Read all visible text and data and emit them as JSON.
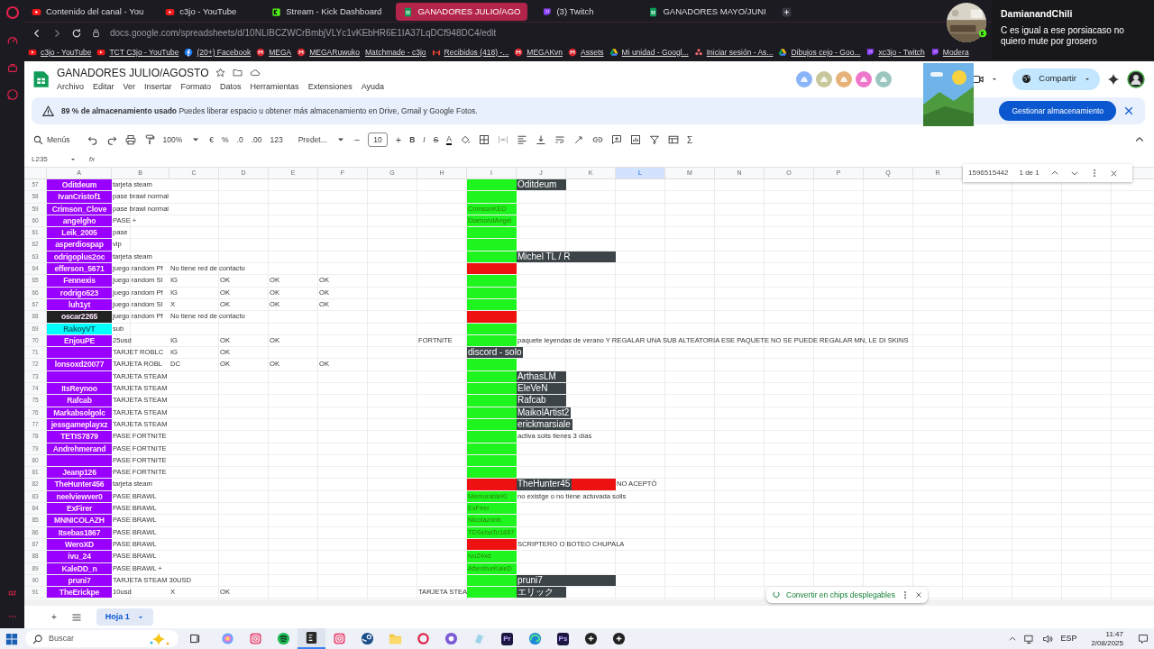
{
  "browser": {
    "tabs": [
      {
        "label": "Contenido del canal - You",
        "kind": "video",
        "selected": false
      },
      {
        "label": "c3jo - YouTube",
        "kind": "video",
        "selected": false
      },
      {
        "label": "Stream - Kick Dashboard",
        "kind": "kick",
        "selected": false
      },
      {
        "label": "GANADORES JULIO/AGO",
        "kind": "sheet",
        "selected": true
      },
      {
        "label": "(3) Twitch",
        "kind": "twitch",
        "selected": false
      },
      {
        "label": "GANADORES MAYO/JUNI",
        "kind": "sheet",
        "selected": false
      }
    ],
    "address": "docs.google.com/spreadsheets/d/10NLIBCZWCrBmbjVLYc1vKEbHR6E1IA37LqDCf948DC4/edit",
    "bookmarks": [
      {
        "label": "c3jo - YouTube",
        "kind": "video"
      },
      {
        "label": "TCT C3jo - YouTube",
        "kind": "video"
      },
      {
        "label": "(20+) Facebook",
        "kind": "social"
      },
      {
        "label": "MEGA",
        "kind": "mega"
      },
      {
        "label": "MEGARuwuko",
        "kind": "mega"
      },
      {
        "label": "Matchmade - c3jo",
        "kind": "blank"
      },
      {
        "label": "Recibidos (418) -...",
        "kind": "mail"
      },
      {
        "label": "MEGAKvn",
        "kind": "mega"
      },
      {
        "label": "Assets",
        "kind": "mega"
      },
      {
        "label": "Mi unidad - Googl...",
        "kind": "drive"
      },
      {
        "label": "Iniciar sesión - As...",
        "kind": "dots"
      },
      {
        "label": "Dibujos cejo - Goo...",
        "kind": "drive"
      },
      {
        "label": "xc3jo - Twitch",
        "kind": "twitch"
      },
      {
        "label": "Modera",
        "kind": "twitch"
      }
    ]
  },
  "notification": {
    "user": "DamianandChili",
    "message": "C es igual a ese porsiacaso no quiero mute por grosero"
  },
  "sheet": {
    "title": "GANADORES JULIO/AGOSTO",
    "menu": [
      "Archivo",
      "Editar",
      "Ver",
      "Insertar",
      "Formato",
      "Datos",
      "Herramientas",
      "Extensiones",
      "Ayuda"
    ],
    "collaborators": [
      {
        "color": "#8ab4f8"
      },
      {
        "color": "#c8c89c"
      },
      {
        "color": "#e6b27a"
      },
      {
        "color": "#ee77cc"
      },
      {
        "color": "#9cc7c0"
      }
    ],
    "share": "Compartir",
    "banner": {
      "text": "**89 % de almacenamiento usado** Puedes liberar espacio u obtener más almacenamiento en Drive, Gmail y Google Fotos.",
      "button": "Gestionar almacenamiento"
    },
    "toolbar": {
      "search": "Menús",
      "zoom": "100%",
      "currency": "€",
      "percent": "%",
      "dec_less": ".0",
      "dec_more": ".00",
      "number_format": "123",
      "font": "Predet...",
      "minus": "−",
      "font_size": "10",
      "plus": "+",
      "bold": "B",
      "italic": "I",
      "strike": "S",
      "text_color": "A",
      "sum": "Σ"
    },
    "name_box": "L235",
    "fx": "fx",
    "find": {
      "query": "1596515442",
      "count": "1 de 1"
    },
    "columns": [
      {
        "label": "A",
        "selected": false
      },
      {
        "label": "B",
        "selected": false
      },
      {
        "label": "C",
        "selected": false
      },
      {
        "label": "D",
        "selected": false
      },
      {
        "label": "E",
        "selected": false
      },
      {
        "label": "F",
        "selected": false
      },
      {
        "label": "G",
        "selected": false
      },
      {
        "label": "H",
        "selected": false
      },
      {
        "label": "I",
        "selected": false
      },
      {
        "label": "J",
        "selected": false
      },
      {
        "label": "K",
        "selected": false
      },
      {
        "label": "L",
        "selected": true
      },
      {
        "label": "M",
        "selected": false
      },
      {
        "label": "N",
        "selected": false
      },
      {
        "label": "O",
        "selected": false
      },
      {
        "label": "P",
        "selected": false
      },
      {
        "label": "Q",
        "selected": false
      },
      {
        "label": "R",
        "selected": false
      }
    ],
    "rows": [
      {
        "n": "57",
        "cells": [
          {
            "kind": "name",
            "text": "Oditdeum",
            "color": "#9900ff"
          },
          {
            "kind": "plain",
            "text": "tarjeta steam"
          },
          "",
          "",
          "",
          "",
          "",
          "",
          {
            "kind": "plain",
            "color": "#1ef51e"
          },
          {
            "kind": "chip",
            "text": "Oditdeum",
            "color": "#3c4448"
          }
        ]
      },
      {
        "n": "58",
        "cells": [
          {
            "kind": "name",
            "text": "IvanCristof1",
            "color": "#9900ff"
          },
          {
            "kind": "plain",
            "text": "pase brawl normal"
          },
          "",
          "",
          "",
          "",
          "",
          "",
          {
            "kind": "plain",
            "color": "#1ef51e"
          }
        ]
      },
      {
        "n": "59",
        "cells": [
          {
            "kind": "name",
            "text": "Crimson_Clove",
            "color": "#9900ff"
          },
          {
            "kind": "plain",
            "text": "pase brawl normal"
          },
          "",
          "",
          "",
          "",
          "",
          "",
          {
            "kind": "note",
            "text": "CrimsonKED",
            "color": "#1ef51e"
          }
        ]
      },
      {
        "n": "60",
        "cells": [
          {
            "kind": "name",
            "text": "angelgho",
            "color": "#9900ff"
          },
          {
            "kind": "plain",
            "text": "PASE +"
          },
          "",
          "",
          "",
          "",
          "",
          "",
          {
            "kind": "note",
            "text": "DiamondAngel",
            "color": "#1ef51e"
          }
        ]
      },
      {
        "n": "61",
        "cells": [
          {
            "kind": "name",
            "text": "Leik_2005",
            "color": "#9900ff"
          },
          {
            "kind": "plain",
            "text": "pase"
          },
          "",
          "",
          "",
          "",
          "",
          "",
          {
            "kind": "plain",
            "color": "#1ef51e"
          }
        ]
      },
      {
        "n": "62",
        "cells": [
          {
            "kind": "name",
            "text": "asperdiospap",
            "color": "#9900ff"
          },
          {
            "kind": "plain",
            "text": "vip"
          },
          "",
          "",
          "",
          "",
          "",
          "",
          {
            "kind": "plain",
            "color": "#1ef51e"
          }
        ]
      },
      {
        "n": "63",
        "cells": [
          {
            "kind": "name",
            "text": "odrigoplus2oc",
            "color": "#9900ff"
          },
          {
            "kind": "plain",
            "text": "tarjeta steam"
          },
          "",
          "",
          "",
          "",
          "",
          "",
          {
            "kind": "plain",
            "color": "#1ef51e"
          },
          {
            "kind": "chip",
            "text": "Michel TL / R",
            "color": "#3c4448",
            "merged": true
          }
        ]
      },
      {
        "n": "64",
        "cells": [
          {
            "kind": "name",
            "text": "efferson_5671",
            "color": "#9900ff"
          },
          {
            "kind": "plain",
            "text": "juego random Pf"
          },
          {
            "kind": "plain",
            "text": "No tiene red de contacto"
          },
          "",
          "",
          "",
          "",
          "",
          {
            "kind": "plain",
            "color": "#ee1111"
          }
        ]
      },
      {
        "n": "65",
        "cells": [
          {
            "kind": "name",
            "text": "Fennexis",
            "color": "#9900ff"
          },
          {
            "kind": "plain",
            "text": "juego random Sl"
          },
          {
            "kind": "plain",
            "text": "IG"
          },
          {
            "kind": "plain",
            "text": "OK"
          },
          {
            "kind": "plain",
            "text": "OK"
          },
          {
            "kind": "plain",
            "text": "OK"
          },
          "",
          "",
          {
            "kind": "plain",
            "color": "#1ef51e"
          }
        ]
      },
      {
        "n": "66",
        "cells": [
          {
            "kind": "name",
            "text": "rodrigo523",
            "color": "#9900ff"
          },
          {
            "kind": "plain",
            "text": "juego random Pf"
          },
          {
            "kind": "plain",
            "text": "IG"
          },
          {
            "kind": "plain",
            "text": "OK"
          },
          {
            "kind": "plain",
            "text": "OK"
          },
          {
            "kind": "plain",
            "text": "OK"
          },
          "",
          "",
          {
            "kind": "plain",
            "color": "#1ef51e"
          }
        ]
      },
      {
        "n": "67",
        "cells": [
          {
            "kind": "name",
            "text": "luh1yt",
            "color": "#9900ff"
          },
          {
            "kind": "plain",
            "text": "juego random Sl"
          },
          {
            "kind": "plain",
            "text": "X"
          },
          {
            "kind": "plain",
            "text": "OK"
          },
          {
            "kind": "plain",
            "text": "OK"
          },
          {
            "kind": "plain",
            "text": "OK"
          },
          "",
          "",
          {
            "kind": "plain",
            "color": "#1ef51e"
          }
        ]
      },
      {
        "n": "68",
        "cells": [
          {
            "kind": "name",
            "text": "oscar2265",
            "color": "#222222"
          },
          {
            "kind": "plain",
            "text": "juego random Pf"
          },
          {
            "kind": "plain",
            "text": "No tiene red de contacto"
          },
          "",
          "",
          "",
          "",
          "",
          {
            "kind": "plain",
            "color": "#ee1111"
          }
        ]
      },
      {
        "n": "69",
        "cells": [
          {
            "kind": "name",
            "text": "RakoyVT",
            "color": "#00ffff"
          },
          {
            "kind": "plain",
            "text": "sub"
          },
          "",
          "",
          "",
          "",
          "",
          "",
          {
            "kind": "plain",
            "color": "#1ef51e"
          }
        ]
      },
      {
        "n": "70",
        "cells": [
          {
            "kind": "name",
            "text": "EnjouPE",
            "color": "#9900ff"
          },
          {
            "kind": "plain",
            "text": "25usd"
          },
          {
            "kind": "plain",
            "text": "IG"
          },
          {
            "kind": "plain",
            "text": "OK"
          },
          {
            "kind": "plain",
            "text": "OK"
          },
          "",
          "",
          {
            "kind": "plain",
            "text": "FORTNITE"
          },
          {
            "kind": "plain",
            "color": "#1ef51e"
          },
          {
            "kind": "plain",
            "text": "paquete leyendas de verano Y REGALAR UNA SUB ALTEATORIA   ESE PAQUETE NO SE PUEDE REGALAR MN, LE DI SKINS"
          }
        ]
      },
      {
        "n": "71",
        "cells": [
          {
            "kind": "name",
            "color": "#9900ff"
          },
          {
            "kind": "plain",
            "text": "TARJET ROBLC"
          },
          {
            "kind": "plain",
            "text": "IG"
          },
          {
            "kind": "plain",
            "text": "OK"
          },
          "",
          "",
          "",
          "",
          {
            "kind": "chip",
            "text": "discord - solo",
            "color": "#3c4448"
          }
        ]
      },
      {
        "n": "72",
        "cells": [
          {
            "kind": "name",
            "text": "lonsoxd20077",
            "color": "#9900ff"
          },
          {
            "kind": "plain",
            "text": "TARJETA ROBL"
          },
          {
            "kind": "plain",
            "text": "DC"
          },
          {
            "kind": "plain",
            "text": "OK"
          },
          {
            "kind": "plain",
            "text": "OK"
          },
          {
            "kind": "plain",
            "text": "OK"
          },
          "",
          "",
          {
            "kind": "plain",
            "color": "#1ef51e"
          }
        ]
      },
      {
        "n": "73",
        "cells": [
          {
            "kind": "name",
            "color": "#9900ff"
          },
          {
            "kind": "plain",
            "text": "TARJETA STEAM"
          },
          "",
          "",
          "",
          "",
          "",
          "",
          {
            "kind": "plain",
            "color": "#1ef51e"
          },
          {
            "kind": "chip",
            "text": "ArthasLM",
            "color": "#3c4448"
          }
        ]
      },
      {
        "n": "74",
        "cells": [
          {
            "kind": "name",
            "text": "ItsReynoo",
            "color": "#9900ff"
          },
          {
            "kind": "plain",
            "text": "TARJETA STEAM"
          },
          "",
          "",
          "",
          "",
          "",
          "",
          {
            "kind": "plain",
            "color": "#1ef51e"
          },
          {
            "kind": "chip",
            "text": "EleVeN",
            "color": "#3c4448"
          }
        ]
      },
      {
        "n": "75",
        "cells": [
          {
            "kind": "name",
            "text": "Rafcab",
            "color": "#9900ff"
          },
          {
            "kind": "plain",
            "text": "TARJETA STEAM"
          },
          "",
          "",
          "",
          "",
          "",
          "",
          {
            "kind": "plain",
            "color": "#1ef51e"
          },
          {
            "kind": "chip",
            "text": "Rafcab",
            "color": "#3c4448"
          }
        ]
      },
      {
        "n": "76",
        "cells": [
          {
            "kind": "name",
            "text": "Markabsolgolc",
            "color": "#9900ff"
          },
          {
            "kind": "plain",
            "text": "TARJETA STEAM"
          },
          "",
          "",
          "",
          "",
          "",
          "",
          {
            "kind": "plain",
            "color": "#1ef51e"
          },
          {
            "kind": "chip",
            "text": "MaikolArtist2",
            "color": "#3c4448"
          }
        ]
      },
      {
        "n": "77",
        "cells": [
          {
            "kind": "name",
            "text": "jessgameplayxz",
            "color": "#9900ff"
          },
          {
            "kind": "plain",
            "text": "TARJETA STEAM"
          },
          "",
          "",
          "",
          "",
          "",
          "",
          {
            "kind": "plain",
            "color": "#1ef51e"
          },
          {
            "kind": "chip",
            "text": "erickmarsiale",
            "color": "#3c4448"
          }
        ]
      },
      {
        "n": "78",
        "cells": [
          {
            "kind": "name",
            "text": "TETIS7879",
            "color": "#9900ff"
          },
          {
            "kind": "plain",
            "text": "PASE FORTNITE"
          },
          "",
          "",
          "",
          "",
          "",
          "",
          {
            "kind": "plain",
            "color": "#1ef51e"
          },
          {
            "kind": "plain",
            "text": "activa solis tienes 3 días"
          }
        ]
      },
      {
        "n": "79",
        "cells": [
          {
            "kind": "name",
            "text": "Andrehmerand",
            "color": "#9900ff"
          },
          {
            "kind": "plain",
            "text": "PASE FORTNITE"
          },
          "",
          "",
          "",
          "",
          "",
          "",
          {
            "kind": "plain",
            "color": "#1ef51e"
          }
        ]
      },
      {
        "n": "80",
        "cells": [
          {
            "kind": "name",
            "color": "#9900ff"
          },
          {
            "kind": "plain",
            "text": "PASE FORTNITE"
          },
          "",
          "",
          "",
          "",
          "",
          "",
          {
            "kind": "plain",
            "color": "#1ef51e"
          }
        ]
      },
      {
        "n": "81",
        "cells": [
          {
            "kind": "name",
            "text": "Jeanp126",
            "color": "#9900ff"
          },
          {
            "kind": "plain",
            "text": "PASE FORTNITE"
          },
          "",
          "",
          "",
          "",
          "",
          "",
          {
            "kind": "plain",
            "color": "#1ef51e"
          }
        ]
      },
      {
        "n": "82",
        "cells": [
          {
            "kind": "name",
            "text": "TheHunter456",
            "color": "#9900ff"
          },
          {
            "kind": "plain",
            "text": "tarjeta steam"
          },
          "",
          "",
          "",
          "",
          "",
          "",
          {
            "kind": "plain",
            "color": "#ee1111"
          },
          {
            "kind": "chip",
            "text": "TheHunter45",
            "color": "#3c4448"
          },
          {
            "kind": "plain",
            "color": "#ee1111"
          },
          {
            "kind": "plain",
            "text": "NO ACEPTÓ"
          }
        ]
      },
      {
        "n": "83",
        "cells": [
          {
            "kind": "name",
            "text": "neelviewver0",
            "color": "#9900ff"
          },
          {
            "kind": "plain",
            "text": "PASE BRAWL"
          },
          "",
          "",
          "",
          "",
          "",
          "",
          {
            "kind": "note",
            "text": "MemorableKi",
            "color": "#1ef51e"
          },
          {
            "kind": "plain",
            "text": "no existge o no tiene actuvada solis"
          }
        ]
      },
      {
        "n": "84",
        "cells": [
          {
            "kind": "name",
            "text": "ExFirer",
            "color": "#9900ff"
          },
          {
            "kind": "plain",
            "text": "PASE BRAWL"
          },
          "",
          "",
          "",
          "",
          "",
          "",
          {
            "kind": "note",
            "text": "ExFirer",
            "color": "#1ef51e"
          }
        ]
      },
      {
        "n": "85",
        "cells": [
          {
            "kind": "name",
            "text": "MNNICOLAZH",
            "color": "#9900ff"
          },
          {
            "kind": "plain",
            "text": "PASE BRAWL"
          },
          "",
          "",
          "",
          "",
          "",
          "",
          {
            "kind": "note",
            "text": "Nicolaznnb",
            "color": "#1ef51e"
          }
        ]
      },
      {
        "n": "86",
        "cells": [
          {
            "kind": "name",
            "text": "Itsebas1867",
            "color": "#9900ff"
          },
          {
            "kind": "plain",
            "text": "PASE BRAWL"
          },
          "",
          "",
          "",
          "",
          "",
          "",
          {
            "kind": "note",
            "text": "TDSebaTo1867",
            "color": "#1ef51e"
          }
        ]
      },
      {
        "n": "87",
        "cells": [
          {
            "kind": "name",
            "text": "WeroXD",
            "color": "#9900ff"
          },
          {
            "kind": "plain",
            "text": "PASE BRAWL"
          },
          "",
          "",
          "",
          "",
          "",
          "",
          {
            "kind": "plain",
            "color": "#ee1111"
          },
          {
            "kind": "plain",
            "text": "SCRIPTERO O BOTEO CHUPALA"
          }
        ]
      },
      {
        "n": "88",
        "cells": [
          {
            "kind": "name",
            "text": "ivu_24",
            "color": "#9900ff"
          },
          {
            "kind": "plain",
            "text": "PASE BRAWL"
          },
          "",
          "",
          "",
          "",
          "",
          "",
          {
            "kind": "note",
            "text": "ivu24xd",
            "color": "#1ef51e"
          }
        ]
      },
      {
        "n": "89",
        "cells": [
          {
            "kind": "name",
            "text": "KaleDD_n",
            "color": "#9900ff"
          },
          {
            "kind": "plain",
            "text": "PASE BRAWL +"
          },
          "",
          "",
          "",
          "",
          "",
          "",
          {
            "kind": "note",
            "text": "AttentiveKaleD",
            "color": "#1ef51e"
          }
        ]
      },
      {
        "n": "90",
        "cells": [
          {
            "kind": "name",
            "text": "pruni7",
            "color": "#9900ff"
          },
          {
            "kind": "plain",
            "text": "TARJETA STEAM 30USD"
          },
          "",
          "",
          "",
          "",
          "",
          "",
          {
            "kind": "plain",
            "color": "#1ef51e"
          },
          {
            "kind": "chip",
            "text": "pruni7",
            "color": "#3c4448",
            "merged": true
          }
        ]
      },
      {
        "n": "91",
        "cells": [
          {
            "kind": "name",
            "text": "TheErickpe",
            "color": "#9900ff"
          },
          {
            "kind": "plain",
            "text": "10usd"
          },
          {
            "kind": "plain",
            "text": "X"
          },
          {
            "kind": "plain",
            "text": "OK"
          },
          "",
          "",
          "",
          {
            "kind": "plain",
            "text": "TARJETA STEA"
          },
          {
            "kind": "plain",
            "color": "#1ef51e"
          },
          {
            "kind": "chip",
            "text": "エリック",
            "color": "#3c4448"
          }
        ]
      }
    ],
    "chips_tip": "Convertir en chips desplegables",
    "sheet_tabs": {
      "add": "+",
      "tabs": [
        {
          "label": "Hoja 1",
          "selected": true
        }
      ]
    }
  },
  "taskbar": {
    "search": "Buscar",
    "apps": [
      {
        "kind": "swirl",
        "selected": false
      },
      {
        "kind": "camera",
        "selected": false
      },
      {
        "kind": "music",
        "selected": false
      },
      {
        "kind": "dark",
        "selected": true
      },
      {
        "kind": "camera",
        "selected": false
      },
      {
        "kind": "steam",
        "selected": false
      },
      {
        "kind": "folder",
        "selected": false
      },
      {
        "kind": "ring",
        "selected": false
      },
      {
        "kind": "purple",
        "selected": false
      },
      {
        "kind": "slab",
        "selected": false
      },
      {
        "kind": "lettered",
        "label": "Pr",
        "selected": false
      },
      {
        "kind": "edge",
        "selected": false
      },
      {
        "kind": "lettered",
        "label": "Ps",
        "selected": false
      },
      {
        "kind": "darkcircle",
        "selected": false
      },
      {
        "kind": "darkcircle",
        "selected": false
      }
    ],
    "language": "ESP",
    "time": "11:47",
    "date": "2/08/2025"
  }
}
